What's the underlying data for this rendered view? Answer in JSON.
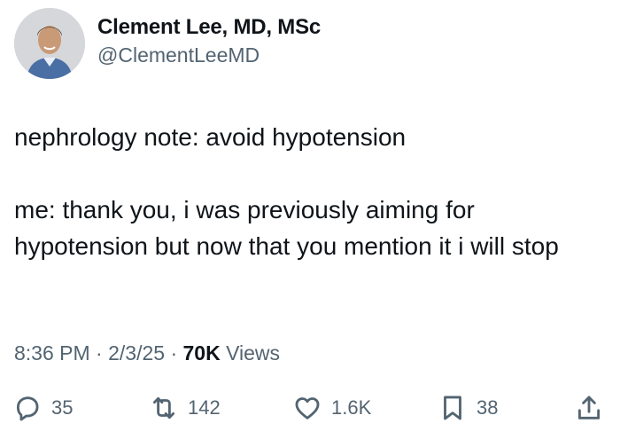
{
  "author": {
    "display_name": "Clement Lee, MD, MSc",
    "handle": "@ClementLeeMD"
  },
  "tweet": {
    "paragraphs": [
      "nephrology note: avoid hypotension",
      "me: thank you, i was previously aiming for hypotension but now that you mention it i will stop"
    ],
    "time": "8:36 PM",
    "date": "2/3/25",
    "views_count": "70K",
    "views_label": "Views",
    "separator": "·"
  },
  "actions": {
    "replies": "35",
    "reposts": "142",
    "likes": "1.6K",
    "bookmarks": "38"
  },
  "colors": {
    "text": "#0f1419",
    "secondary": "#536471",
    "background": "#ffffff"
  },
  "icons": [
    "reply-icon",
    "repost-icon",
    "like-icon",
    "bookmark-icon",
    "share-icon"
  ]
}
